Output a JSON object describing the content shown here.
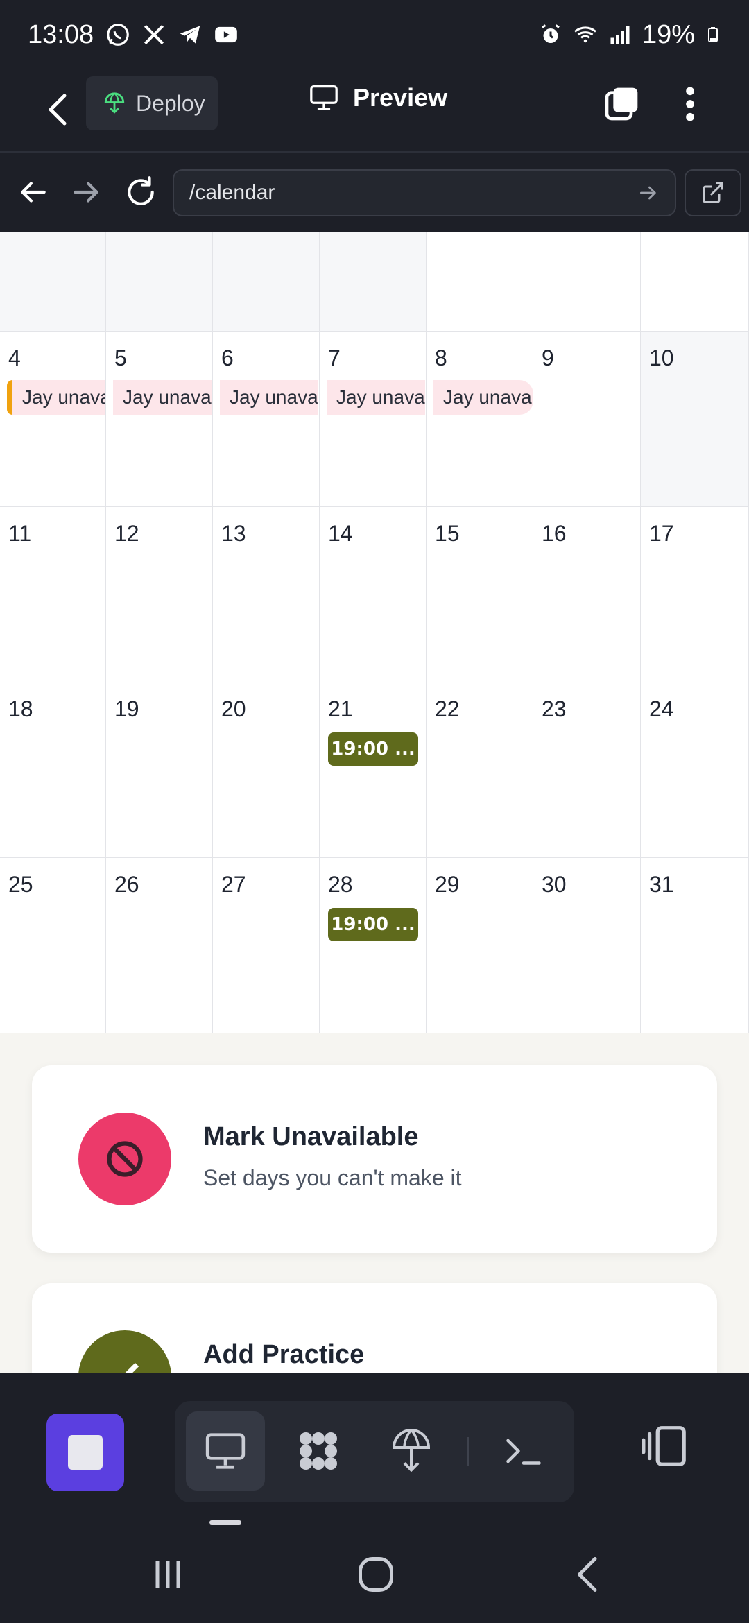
{
  "status_bar": {
    "time": "13:08",
    "battery": "19%",
    "app_icons": [
      "whatsapp-icon",
      "x-icon",
      "telegram-icon",
      "youtube-icon"
    ],
    "system_icons": [
      "alarm-icon",
      "wifi-icon",
      "signal-icon",
      "battery-icon"
    ]
  },
  "header": {
    "deploy_label": "Deploy",
    "preview_label": "Preview"
  },
  "browser": {
    "url": "/calendar"
  },
  "calendar": {
    "unavailable_label": "Jay unava",
    "practice_label": "19:00 ...",
    "weeks": [
      [
        "",
        "",
        "",
        "",
        "",
        "",
        ""
      ],
      [
        "4",
        "5",
        "6",
        "7",
        "8",
        "9",
        "10"
      ],
      [
        "11",
        "12",
        "13",
        "14",
        "15",
        "16",
        "17"
      ],
      [
        "18",
        "19",
        "20",
        "21",
        "22",
        "23",
        "24"
      ],
      [
        "25",
        "26",
        "27",
        "28",
        "29",
        "30",
        "31"
      ]
    ],
    "unavailable_days": [
      "4",
      "5",
      "6",
      "7",
      "8"
    ],
    "practice_days": [
      "21",
      "28"
    ]
  },
  "actions": {
    "mark_unavailable": {
      "title": "Mark Unavailable",
      "subtitle": "Set days you can't make it"
    },
    "add_practice": {
      "title": "Add Practice"
    }
  },
  "colors": {
    "accent_purple": "#5b3fe0",
    "unavailable_red": "#ec3a6a",
    "practice_olive": "#5f6a1c",
    "unavailable_chip_bg": "#fde6ea",
    "chip_marker_orange": "#f0a20f"
  },
  "toolbar": {
    "tools": [
      "stop-icon",
      "preview-icon",
      "apps-icon",
      "deploy-icon",
      "terminal-icon",
      "side-panel-icon"
    ]
  }
}
